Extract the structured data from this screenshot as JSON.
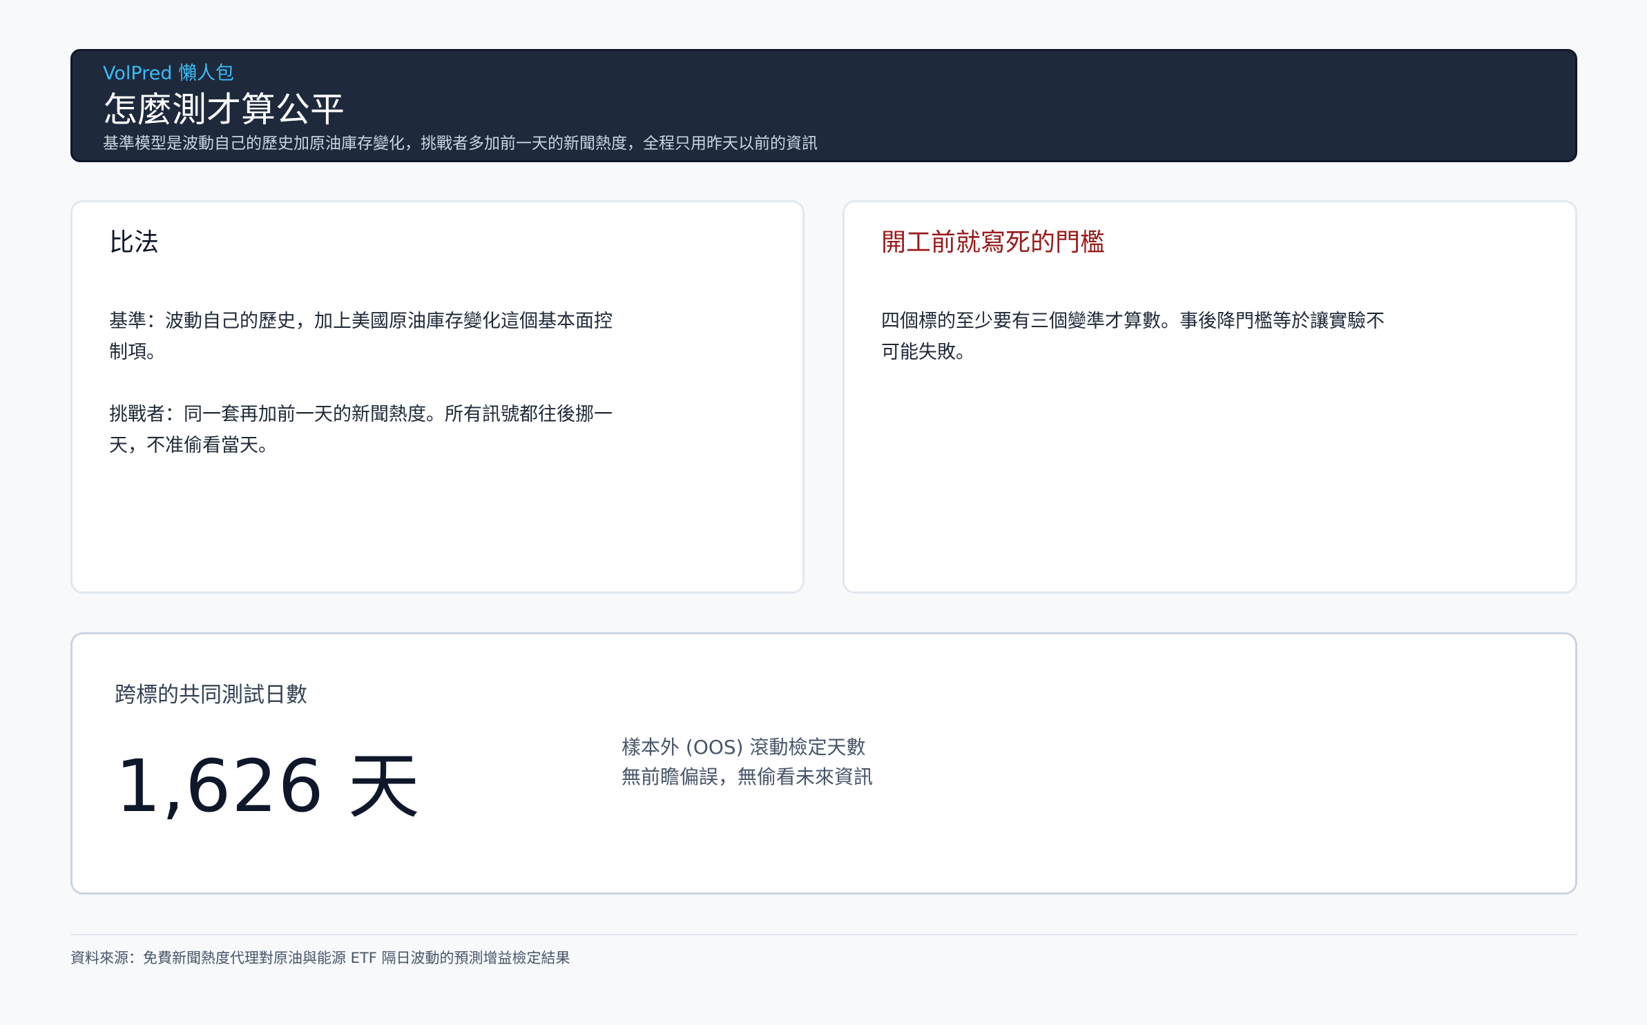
{
  "header": {
    "kicker": "VolPred 懶人包",
    "title": "怎麼測才算公平",
    "subtitle": "基準模型是波動自己的歷史加原油庫存變化，挑戰者多加前一天的新聞熱度，全程只用昨天以前的資訊"
  },
  "method_card": {
    "title": "比法",
    "paragraphs": [
      "基準：波動自己的歷史，加上美國原油庫存變化這個基本面控制項。",
      "挑戰者：同一套再加前一天的新聞熱度。所有訊號都往後挪一天，不准偷看當天。"
    ]
  },
  "threshold_card": {
    "title": "開工前就寫死的門檻",
    "paragraphs": [
      "四個標的至少要有三個變準才算數。事後降門檻等於讓實驗不可能失敗。"
    ]
  },
  "stat": {
    "label": "跨標的共同測試日數",
    "value": "1,626 天",
    "note_line1": "樣本外 (OOS) 滾動檢定天數",
    "note_line2": "無前瞻偏誤，無偷看未來資訊"
  },
  "footer": {
    "source": "資料來源：免費新聞熱度代理對原油與能源 ETF 隔日波動的預測增益檢定結果"
  }
}
